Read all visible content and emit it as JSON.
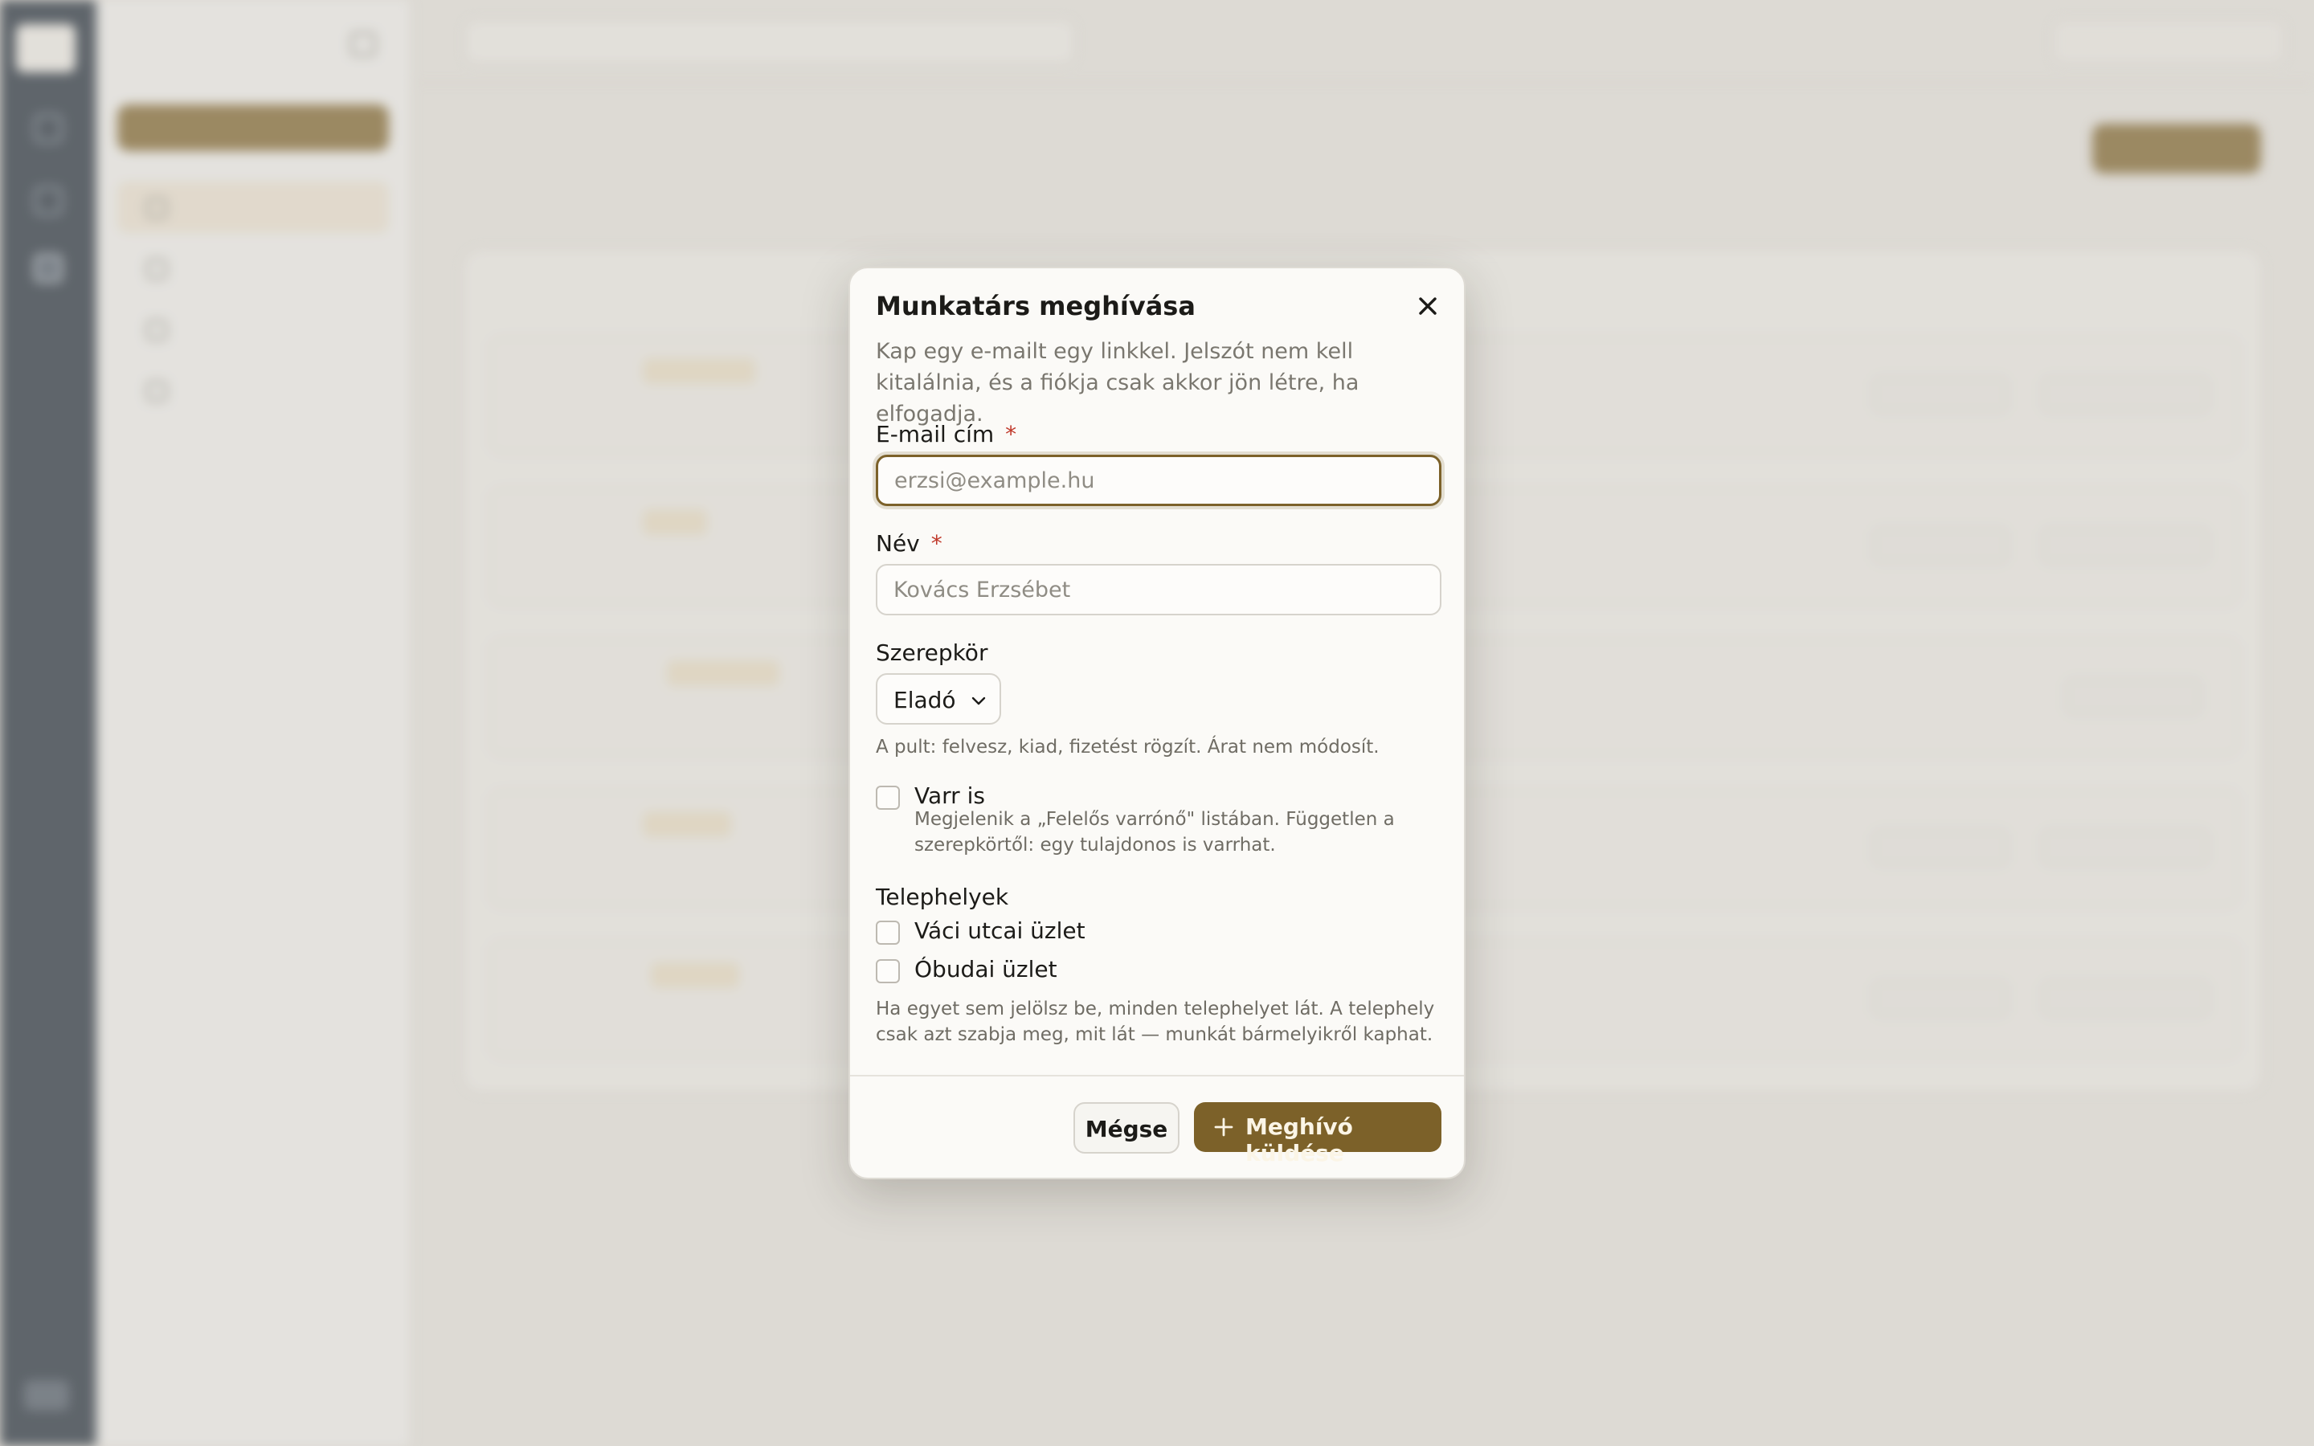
{
  "dialog": {
    "title": "Munkatárs meghívása",
    "description": "Kap egy e-mailt egy linkkel. Jelszót nem kell kitalálnia, és a fiókja csak akkor jön létre, ha elfogadja.",
    "email": {
      "label": "E-mail cím",
      "required_mark": "*",
      "value": "",
      "placeholder": "erzsi@example.hu"
    },
    "name": {
      "label": "Név",
      "required_mark": "*",
      "value": "",
      "placeholder": "Kovács Erzsébet"
    },
    "role": {
      "label": "Szerepkör",
      "selected": "Eladó",
      "help": "A pult: felvesz, kiad, fizetést rögzít. Árat nem módosít."
    },
    "sews": {
      "label": "Varr is",
      "checked": false,
      "help": "Megjelenik a „Felelős varrónő\" listában. Független a szerepkörtől: egy tulajdonos is varrhat."
    },
    "locations": {
      "label": "Telephelyek",
      "items": [
        {
          "label": "Váci utcai üzlet",
          "checked": false
        },
        {
          "label": "Óbudai üzlet",
          "checked": false
        }
      ],
      "help": "Ha egyet sem jelölsz be, minden telephelyet lát. A telephely csak azt szabja meg, mit lát — munkát bármelyikről kaphat."
    },
    "cancel_label": "Mégse",
    "submit_label": "Meghívó küldése"
  },
  "colors": {
    "accent": "#7c6129",
    "rail": "#1f2a36",
    "required": "#c0392b",
    "backdrop": "#e0ddd7"
  },
  "icons": {
    "close": "close-icon",
    "chevron": "chevron-down-icon",
    "submit": "plus-icon"
  }
}
